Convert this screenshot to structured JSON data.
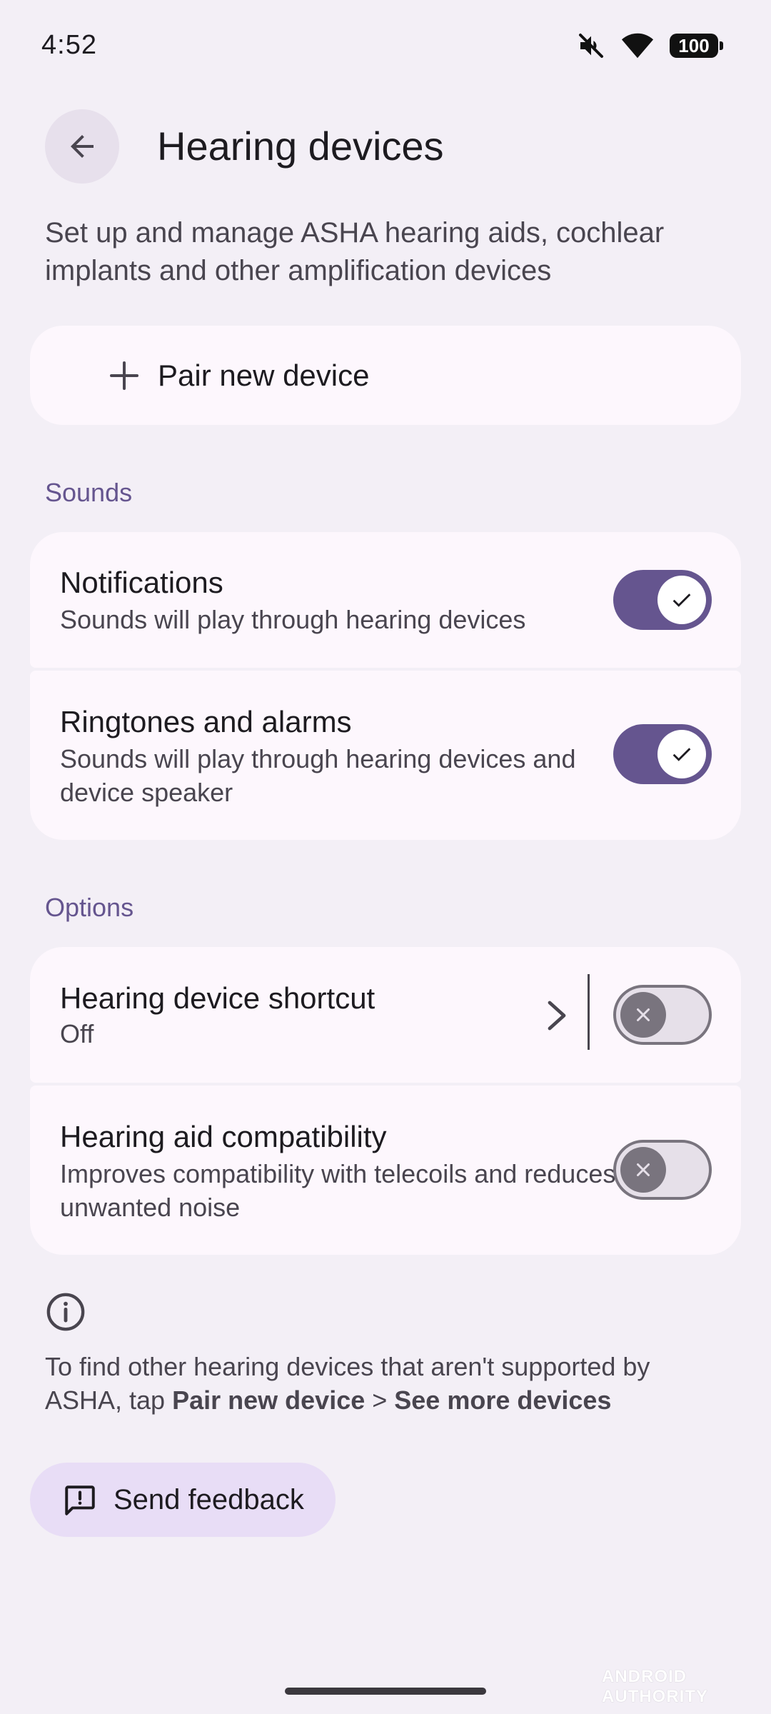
{
  "status_bar": {
    "time": "4:52",
    "battery": "100",
    "icons": [
      "mute-icon",
      "wifi-icon",
      "battery-icon"
    ]
  },
  "header": {
    "back_icon": "arrow-back-icon",
    "title": "Hearing devices"
  },
  "description": "Set up and manage ASHA hearing aids, cochlear implants and other amplification devices",
  "pair": {
    "icon": "plus-icon",
    "label": "Pair new device"
  },
  "sounds": {
    "header": "Sounds",
    "items": [
      {
        "title": "Notifications",
        "subtitle": "Sounds will play through hearing devices",
        "enabled": true
      },
      {
        "title": "Ringtones and alarms",
        "subtitle": "Sounds will play through hearing devices and device speaker",
        "enabled": true
      }
    ]
  },
  "options": {
    "header": "Options",
    "items": [
      {
        "title": "Hearing device shortcut",
        "subtitle": "Off",
        "enabled": false
      },
      {
        "title": "Hearing aid compatibility",
        "subtitle": "Improves compatibility with telecoils and reduces unwanted noise",
        "enabled": false
      }
    ]
  },
  "footer": {
    "icon": "info-icon",
    "text_prefix": "To find other hearing devices that aren't supported by ASHA, tap ",
    "text_bold_1": "Pair new device",
    "text_separator": " > ",
    "text_bold_2": "See more devices"
  },
  "feedback": {
    "icon": "feedback-icon",
    "label": "Send feedback"
  },
  "watermark": "ANDROID AUTHORITY",
  "colors": {
    "background": "#f3eff6",
    "card": "#fdf7fd",
    "accent": "#65558f",
    "feedback_button": "#e8ddf6"
  }
}
